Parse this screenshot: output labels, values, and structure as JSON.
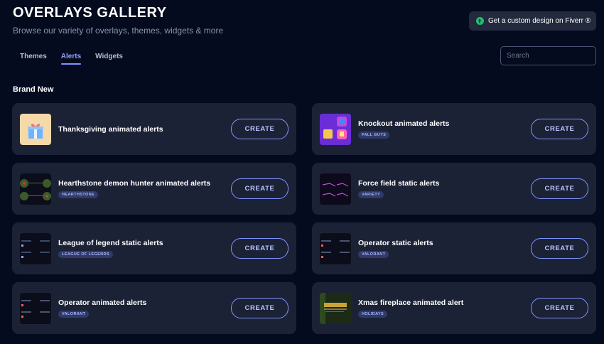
{
  "header": {
    "title": "OVERLAYS GALLERY",
    "subtitle": "Browse our variety of overlays, themes, widgets & more",
    "fiverr_label": "Get a custom design on Fiverr ®",
    "fiverr_icon": "fiverr-logo-icon"
  },
  "tabs": [
    {
      "label": "Themes",
      "active": false
    },
    {
      "label": "Alerts",
      "active": true
    },
    {
      "label": "Widgets",
      "active": false
    }
  ],
  "search": {
    "placeholder": "Search",
    "value": ""
  },
  "section": {
    "title": "Brand New"
  },
  "cards": [
    {
      "title": "Thanksgiving animated alerts",
      "tag": "",
      "button": "CREATE"
    },
    {
      "title": "Knockout animated alerts",
      "tag": "FALL GUYS",
      "button": "CREATE"
    },
    {
      "title": "Hearthstone demon hunter animated alerts",
      "tag": "HEARTHSTONE",
      "button": "CREATE"
    },
    {
      "title": "Force field static alerts",
      "tag": "VARIETY",
      "button": "CREATE"
    },
    {
      "title": "League of legend static alerts",
      "tag": "LEAGUE OF LEGENDS",
      "button": "CREATE"
    },
    {
      "title": "Operator static alerts",
      "tag": "VALORANT",
      "button": "CREATE"
    },
    {
      "title": "Operator animated alerts",
      "tag": "VALORANT",
      "button": "CREATE"
    },
    {
      "title": "Xmas fireplace animated alert",
      "tag": "HOLIDAYS",
      "button": "CREATE"
    }
  ],
  "colors": {
    "background": "#050b1f",
    "card": "#1c2236",
    "accent": "#7f93ff",
    "tag_bg": "#2f3a68"
  }
}
